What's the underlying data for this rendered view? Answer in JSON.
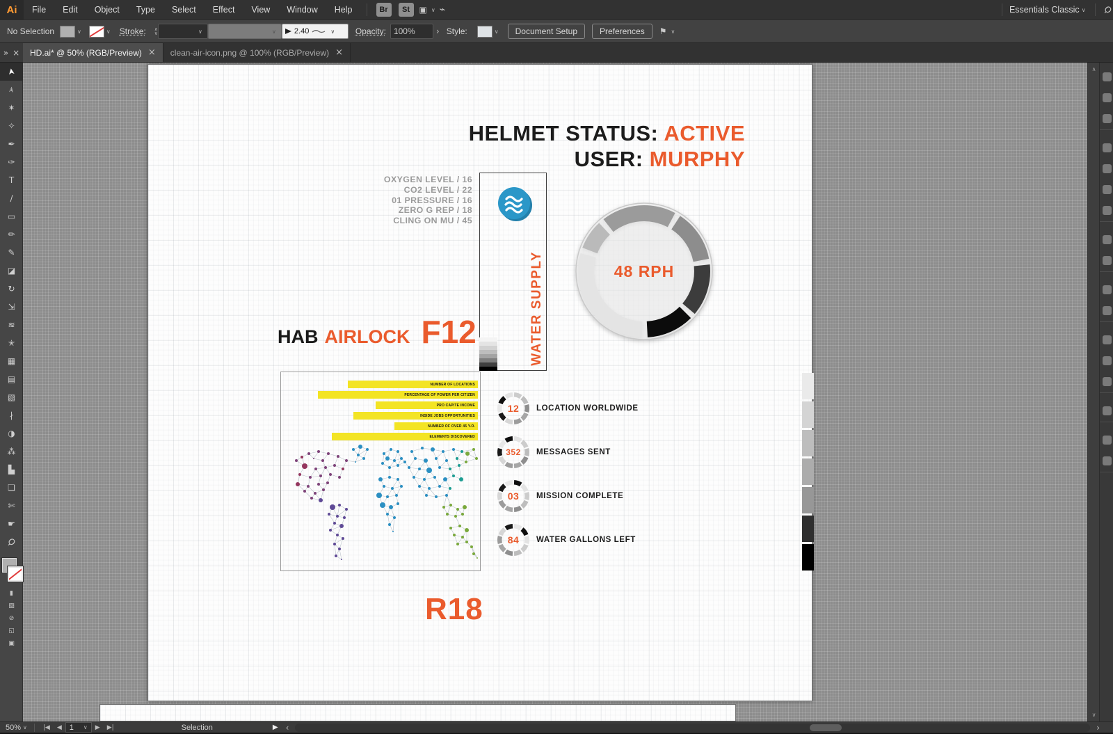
{
  "app": {
    "logo_text": "Ai",
    "menus": [
      "File",
      "Edit",
      "Object",
      "Type",
      "Select",
      "Effect",
      "View",
      "Window",
      "Help"
    ],
    "bridge_button": "Br",
    "stock_button": "St",
    "workspace_label": "Essentials Classic"
  },
  "control_bar": {
    "selection_status": "No Selection",
    "stroke_label": "Stroke:",
    "weight_value": "2.40",
    "opacity_label": "Opacity:",
    "opacity_value": "100%",
    "style_label": "Style:",
    "document_setup_label": "Document Setup",
    "preferences_label": "Preferences"
  },
  "tabs": [
    {
      "title": "HD.ai* @ 50% (RGB/Preview)",
      "active": true
    },
    {
      "title": "clean-air-icon.png @ 100% (RGB/Preview)",
      "active": false
    }
  ],
  "toolbar_tools": [
    "selection",
    "direct-selection",
    "magic-wand",
    "lasso",
    "pen",
    "curvature",
    "type",
    "line-segment",
    "rectangle",
    "paintbrush",
    "shaper",
    "eraser",
    "rotate",
    "free-transform",
    "width",
    "puppet-warp",
    "perspective-grid",
    "mesh",
    "gradient",
    "eyedropper",
    "blend",
    "symbol-sprayer",
    "column-graph",
    "artboard",
    "slice",
    "hand",
    "zoom"
  ],
  "tool_glyphs": {
    "selection": "➤",
    "direct-selection": "➢",
    "magic-wand": "✶",
    "lasso": "✧",
    "pen": "✒",
    "curvature": "✑",
    "type": "T",
    "line-segment": "∕",
    "rectangle": "▭",
    "paintbrush": "✏",
    "shaper": "✎",
    "eraser": "◪",
    "rotate": "↻",
    "free-transform": "⇲",
    "width": "≋",
    "puppet-warp": "✭",
    "perspective-grid": "▦",
    "mesh": "▤",
    "gradient": "▧",
    "eyedropper": "∤",
    "blend": "◑",
    "symbol-sprayer": "⁂",
    "column-graph": "▙",
    "artboard": "❏",
    "slice": "✄",
    "hand": "☛",
    "zoom": "Ϙ"
  },
  "icons": {
    "chevron_down": "∨",
    "chevron_up": "∧",
    "close": "×",
    "overflow": "»",
    "scroll_left": "‹",
    "scroll_right": "›",
    "prev": "◀",
    "next": "▶",
    "play": "▶",
    "angle_right": "›"
  },
  "status_bar": {
    "zoom_level": "50%",
    "artboard_number": "1",
    "status_text": "Selection"
  },
  "artboard": {
    "headline": {
      "line1_black": "HELMET STATUS:",
      "line1_orange": "ACTIVE",
      "line2_black": "USER:",
      "line2_orange": "MURPHY"
    },
    "vitals": [
      "OXYGEN LEVEL / 16",
      "CO2 LEVEL / 22",
      "01 PRESSURE / 16",
      "ZERO G REP / 18",
      "CLING ON MU / 45"
    ],
    "water_supply_label": "WATER SUPPLY",
    "gauge": {
      "value_text": "48 RPH",
      "segments": [
        {
          "from": -38,
          "to": 28,
          "color": "#9b9b9b"
        },
        {
          "from": 33,
          "to": 79,
          "color": "#8d8d8d"
        },
        {
          "from": 84,
          "to": 130,
          "color": "#3c3c3c"
        },
        {
          "from": 135,
          "to": 177,
          "color": "#0c0c0c"
        },
        {
          "from": 182,
          "to": 286,
          "color": "#e4e4e4"
        },
        {
          "from": 291,
          "to": 317,
          "color": "#bababa"
        }
      ]
    },
    "hab": {
      "prefix": "HAB",
      "word": "AIRLOCK",
      "code": "F12"
    },
    "bar_chart": {
      "type": "bar",
      "labels": [
        "NUMBER OF LOCATIONS",
        "PERCENTAGE OF POWER PER CITIZEN",
        "PRO CAPITE INCOME",
        "INSIDE JOBS OPPORTUNITIES",
        "NUMBER OF OVER 45 Y.O.",
        "ELEMENTS DISCOVERED"
      ],
      "widths": [
        187,
        230,
        147,
        179,
        120,
        210
      ],
      "bar_color": "#f3e424"
    },
    "stats": [
      {
        "value": "12",
        "label": "LOCATION WORLDWIDE"
      },
      {
        "value": "352",
        "label": "MESSAGES SENT"
      },
      {
        "value": "03",
        "label": "MISSION COMPLETE"
      },
      {
        "value": "84",
        "label": "WATER GALLONS LEFT"
      }
    ],
    "footer_code": "R18",
    "colors": {
      "orange": "#ea5b2d",
      "yellow": "#f3e424",
      "blue": "#2b97c8",
      "blue_dark": "#2380ab",
      "gray_text": "#9b9b9b"
    },
    "ring_palette": [
      "#cccccc",
      "#a6a6a6",
      "#191919",
      "#e3e3e3",
      "#8e8e8e",
      "#d6d6d6",
      "#0e0e0e",
      "#bdbdbd",
      "#9c9c9c",
      "#e8e8e8"
    ],
    "grayscale_strip": [
      "#eaeaea",
      "#d4d4d4",
      "#bdbdbd",
      "#acacac",
      "#979797",
      "#2f2f2f",
      "#000000"
    ],
    "mini_scale": [
      "#f4f4f4",
      "#e4e4e4",
      "#d2d2d2",
      "#bdbdbd",
      "#a3a3a3",
      "#7d7d7d",
      "#3f3f3f",
      "#000000"
    ],
    "map": {
      "palette": [
        "#7e4379",
        "#94365e",
        "#5f4a96",
        "#2b8fc2",
        "#1d9d92",
        "#7aa93c"
      ],
      "nodes": [
        [
          30,
          122,
          2,
          1
        ],
        [
          22,
          127,
          2,
          0
        ],
        [
          40,
          117,
          2,
          0
        ],
        [
          54,
          114,
          2,
          0
        ],
        [
          68,
          117,
          2,
          0
        ],
        [
          82,
          121,
          2,
          0
        ],
        [
          94,
          127,
          2,
          0
        ],
        [
          47,
          124,
          1,
          0
        ],
        [
          60,
          127,
          2,
          0
        ],
        [
          34,
          135,
          4,
          1
        ],
        [
          50,
          139,
          2,
          0
        ],
        [
          64,
          137,
          2,
          0
        ],
        [
          77,
          134,
          2,
          0
        ],
        [
          89,
          139,
          2,
          1
        ],
        [
          27,
          147,
          2,
          1
        ],
        [
          42,
          151,
          2,
          0
        ],
        [
          57,
          149,
          2,
          0
        ],
        [
          71,
          147,
          2,
          0
        ],
        [
          84,
          151,
          2,
          0
        ],
        [
          24,
          161,
          3,
          1
        ],
        [
          39,
          164,
          2,
          0
        ],
        [
          54,
          161,
          2,
          0
        ],
        [
          67,
          159,
          2,
          0
        ],
        [
          34,
          171,
          2,
          0
        ],
        [
          49,
          174,
          2,
          0
        ],
        [
          61,
          169,
          2,
          0
        ],
        [
          44,
          181,
          2,
          0
        ],
        [
          57,
          184,
          3,
          2
        ],
        [
          104,
          111,
          2,
          3
        ],
        [
          114,
          107,
          3,
          3
        ],
        [
          124,
          111,
          2,
          3
        ],
        [
          111,
          119,
          2,
          3
        ],
        [
          119,
          124,
          2,
          3
        ],
        [
          107,
          129,
          1,
          3
        ],
        [
          74,
          194,
          4,
          2
        ],
        [
          84,
          191,
          2,
          2
        ],
        [
          94,
          197,
          2,
          2
        ],
        [
          69,
          204,
          2,
          2
        ],
        [
          81,
          207,
          2,
          2
        ],
        [
          91,
          209,
          2,
          2
        ],
        [
          77,
          217,
          2,
          2
        ],
        [
          87,
          221,
          3,
          2
        ],
        [
          71,
          227,
          2,
          2
        ],
        [
          81,
          234,
          2,
          2
        ],
        [
          89,
          239,
          2,
          2
        ],
        [
          77,
          247,
          2,
          2
        ],
        [
          84,
          254,
          2,
          2
        ],
        [
          79,
          264,
          2,
          2
        ],
        [
          87,
          269,
          1,
          2
        ],
        [
          148,
          117,
          2,
          3
        ],
        [
          158,
          111,
          2,
          3
        ],
        [
          168,
          114,
          2,
          3
        ],
        [
          153,
          124,
          3,
          3
        ],
        [
          163,
          127,
          2,
          3
        ],
        [
          173,
          124,
          2,
          3
        ],
        [
          146,
          131,
          2,
          3
        ],
        [
          156,
          137,
          2,
          3
        ],
        [
          168,
          134,
          2,
          3
        ],
        [
          178,
          129,
          2,
          3
        ],
        [
          143,
          154,
          3,
          3
        ],
        [
          156,
          151,
          2,
          3
        ],
        [
          168,
          154,
          2,
          3
        ],
        [
          148,
          164,
          2,
          3
        ],
        [
          160,
          167,
          2,
          3
        ],
        [
          173,
          164,
          2,
          3
        ],
        [
          141,
          177,
          4,
          3
        ],
        [
          153,
          179,
          2,
          3
        ],
        [
          166,
          177,
          2,
          3
        ],
        [
          146,
          191,
          4,
          3
        ],
        [
          158,
          194,
          3,
          3
        ],
        [
          168,
          189,
          2,
          3
        ],
        [
          153,
          204,
          2,
          3
        ],
        [
          163,
          209,
          2,
          3
        ],
        [
          156,
          219,
          2,
          3
        ],
        [
          161,
          229,
          1,
          3
        ],
        [
          188,
          114,
          2,
          3
        ],
        [
          203,
          109,
          2,
          3
        ],
        [
          218,
          111,
          3,
          3
        ],
        [
          233,
          114,
          2,
          3
        ],
        [
          248,
          111,
          2,
          3
        ],
        [
          260,
          114,
          2,
          4
        ],
        [
          193,
          124,
          2,
          3
        ],
        [
          208,
          127,
          3,
          3
        ],
        [
          223,
          124,
          2,
          3
        ],
        [
          238,
          127,
          2,
          3
        ],
        [
          253,
          124,
          2,
          4
        ],
        [
          184,
          137,
          2,
          3
        ],
        [
          199,
          139,
          2,
          3
        ],
        [
          213,
          141,
          4,
          3
        ],
        [
          228,
          137,
          2,
          3
        ],
        [
          243,
          139,
          2,
          4
        ],
        [
          256,
          134,
          2,
          4
        ],
        [
          191,
          151,
          2,
          3
        ],
        [
          206,
          154,
          2,
          3
        ],
        [
          221,
          151,
          2,
          3
        ],
        [
          236,
          154,
          3,
          3
        ],
        [
          259,
          154,
          3,
          4
        ],
        [
          248,
          149,
          2,
          4
        ],
        [
          199,
          164,
          2,
          3
        ],
        [
          213,
          167,
          2,
          3
        ],
        [
          228,
          164,
          2,
          3
        ],
        [
          243,
          167,
          2,
          4
        ],
        [
          209,
          177,
          2,
          3
        ],
        [
          223,
          179,
          2,
          3
        ],
        [
          238,
          177,
          2,
          3
        ],
        [
          268,
          117,
          3,
          5
        ],
        [
          277,
          111,
          2,
          5
        ],
        [
          281,
          124,
          2,
          5
        ],
        [
          266,
          129,
          2,
          5
        ],
        [
          234,
          194,
          2,
          5
        ],
        [
          244,
          191,
          2,
          5
        ],
        [
          254,
          197,
          2,
          5
        ],
        [
          264,
          194,
          3,
          5
        ],
        [
          239,
          204,
          2,
          5
        ],
        [
          251,
          207,
          2,
          5
        ],
        [
          261,
          204,
          2,
          5
        ],
        [
          244,
          224,
          2,
          5
        ],
        [
          257,
          221,
          2,
          5
        ],
        [
          267,
          227,
          3,
          5
        ],
        [
          249,
          234,
          2,
          5
        ],
        [
          261,
          237,
          2,
          5
        ],
        [
          254,
          247,
          2,
          5
        ],
        [
          267,
          244,
          2,
          5
        ],
        [
          274,
          251,
          2,
          5
        ],
        [
          277,
          261,
          2,
          5
        ],
        [
          282,
          267,
          1,
          5
        ]
      ]
    }
  },
  "dock_groups": [
    3,
    4,
    2,
    2,
    3,
    1,
    2
  ]
}
